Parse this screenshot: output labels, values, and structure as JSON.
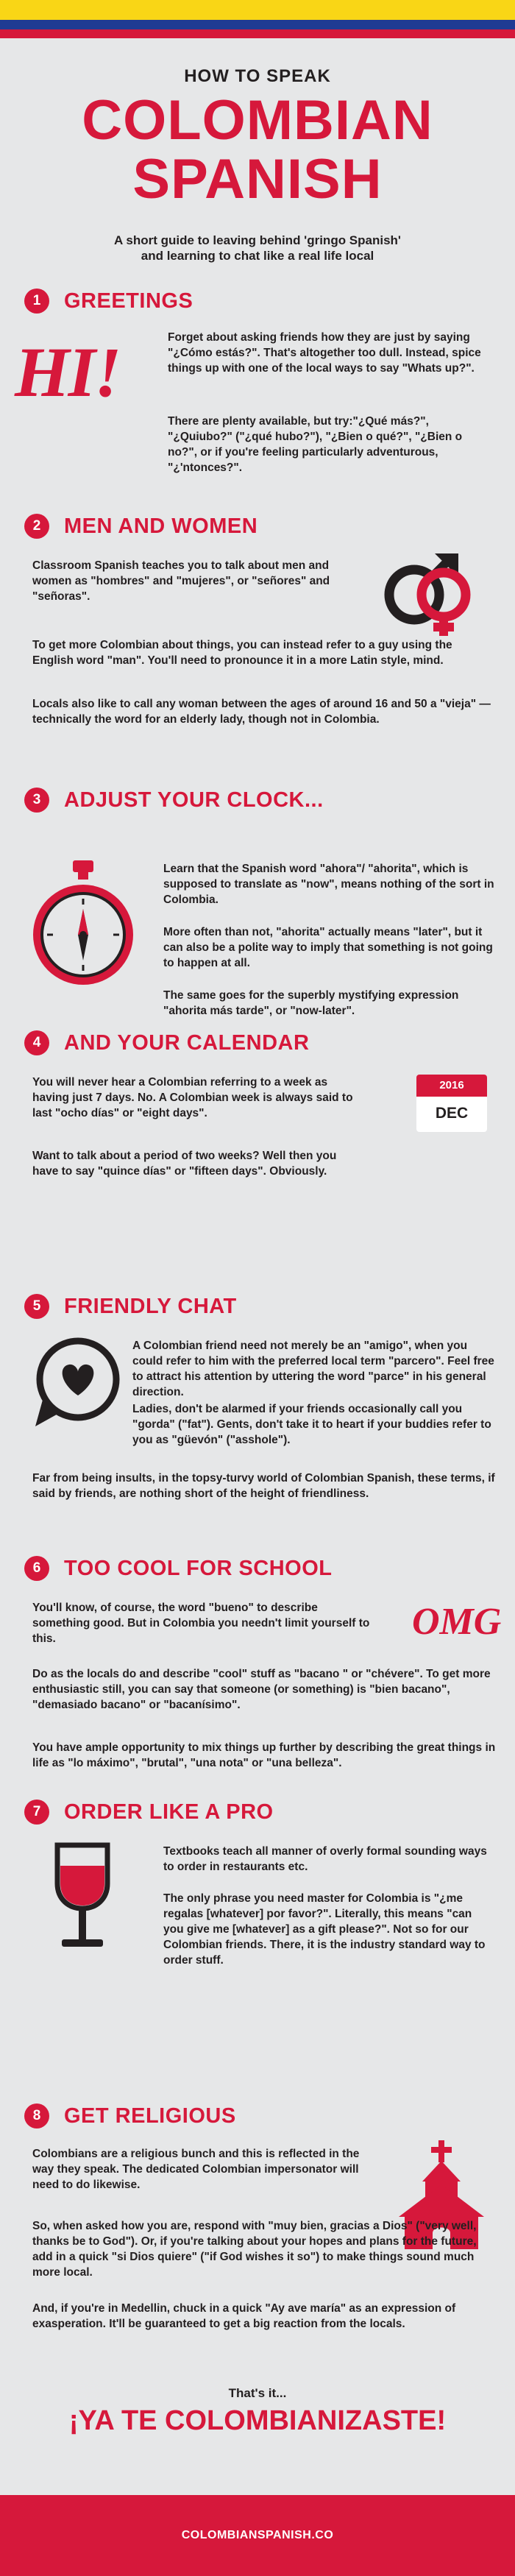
{
  "colors": {
    "red": "#d6183b",
    "yellow": "#f9d616",
    "blue": "#1f3b93",
    "background": "#e6e7e8",
    "text": "#231f20"
  },
  "header": {
    "kicker": "HOW TO SPEAK",
    "title_line1": "COLOMBIAN",
    "title_line2": "SPANISH",
    "intro_line1": "A short guide to leaving behind 'gringo Spanish'",
    "intro_line2": "and learning to chat like a real life local"
  },
  "sections": [
    {
      "num": "1",
      "title": "GREETINGS",
      "icon": "hi-text",
      "art_text": "HI!",
      "paragraphs": [
        "Forget about asking friends how they are just by saying \"¿Cómo estás?\". That's altogether too dull. Instead, spice things up with one of the local ways to say \"Whats up?\".",
        "There are plenty available, but try:\"¿Qué más?\", \"¿Quiubo?\" (\"¿qué hubo?\"), \"¿Bien o qué?\", \"¿Bien o no?\", or if you're feeling particularly adventurous, \"¿'ntonces?\"."
      ]
    },
    {
      "num": "2",
      "title": "MEN AND WOMEN",
      "icon": "gender-icon",
      "paragraphs": [
        "Classroom Spanish teaches you to talk about men and women as \"hombres\" and \"mujeres\", or \"señores\" and \"señoras\".",
        "To get more Colombian about things, you can instead refer to a guy using the English word \"man\". You'll need to pronounce it in a more Latin style, mind.",
        "Locals also like to call any woman between the ages of around 16 and 50 a \"vieja\" — technically the word for an elderly lady, though not in Colombia."
      ]
    },
    {
      "num": "3",
      "title": "ADJUST YOUR CLOCK...",
      "icon": "stopwatch-icon",
      "paragraphs": [
        "Learn that the Spanish word \"ahora\"/ \"ahorita\", which is supposed to translate as \"now\", means nothing of the sort in Colombia.",
        "More often than not, \"ahorita\" actually means \"later\", but it can also be a polite way to imply that something is not going to happen at all.",
        "The same goes for the superbly mystifying expression \"ahorita más tarde\", or \"now-later\"."
      ]
    },
    {
      "num": "4",
      "title": "AND YOUR CALENDAR",
      "icon": "calendar-icon",
      "calendar": {
        "year": "2016",
        "month": "DEC"
      },
      "paragraphs": [
        "You will never hear a Colombian referring to a week as having just 7 days. No. A Colombian week is always said to last \"ocho días\" or \"eight days\".",
        "Want to talk about a period of two weeks? Well then you have to say \"quince días\" or \"fifteen days\". Obviously."
      ]
    },
    {
      "num": "5",
      "title": "FRIENDLY CHAT",
      "icon": "chat-heart-icon",
      "paragraphs": [
        "A Colombian friend need not merely be an \"amigo\", when you could refer to him with the preferred local term \"parcero\". Feel free to attract his attention by uttering the word \"parce\" in his general direction.",
        "Ladies, don't be alarmed if your friends occasionally call you \"gorda\" (\"fat\"). Gents, don't take it to heart if your buddies refer to you as \"güevón\" (\"asshole\").",
        "Far from being insults, in the topsy-turvy world of Colombian Spanish, these terms, if said by friends, are nothing short of the height of friendliness."
      ]
    },
    {
      "num": "6",
      "title": "TOO COOL FOR SCHOOL",
      "icon": "omg-text",
      "art_text": "OMG",
      "paragraphs": [
        "You'll know, of course, the word \"bueno\" to describe something good. But in Colombia you needn't limit yourself to this.",
        "Do as the locals do and describe \"cool\" stuff as \"bacano \" or \"chévere\". To get more enthusiastic still, you can say that someone (or something) is \"bien bacano\", \"demasiado bacano\" or \"bacanísimo\".",
        "You have ample opportunity to mix things up further by describing the great things in life as \"lo máximo\", \"brutal\", \"una nota\" or \"una belleza\"."
      ]
    },
    {
      "num": "7",
      "title": "ORDER LIKE A PRO",
      "icon": "wine-glass-icon",
      "paragraphs": [
        "Textbooks teach all manner of overly formal sounding ways to order in restaurants etc.",
        "The only phrase you need master for Colombia is \"¿me regalas [whatever] por favor?\". Literally, this means \"can you give me [whatever] as a gift please?\". Not so for our Colombian friends. There, it is the industry standard way to order stuff."
      ]
    },
    {
      "num": "8",
      "title": "GET RELIGIOUS",
      "icon": "church-icon",
      "paragraphs": [
        "Colombians are a religious bunch and this is reflected in the way they speak. The dedicated Colombian impersonator will need to do likewise.",
        "So, when asked how you are, respond with \"muy bien, gracias a Dios\" (\"very well, thanks be to God\"). Or, if you're talking about your hopes and plans for the future, add in a quick \"si Dios quiere\" (\"if God wishes it so\") to make things sound much more local.",
        "And, if you're in Medellin, chuck in a quick \"Ay ave maría\" as an expression of exasperation. It'll be guaranteed to get a big reaction from the locals."
      ]
    }
  ],
  "closing": {
    "thats_it": "That's it...",
    "final": "¡YA TE COLOMBIANIZASTE!"
  },
  "footer": {
    "site": "COLOMBIANSPANISH.CO"
  }
}
